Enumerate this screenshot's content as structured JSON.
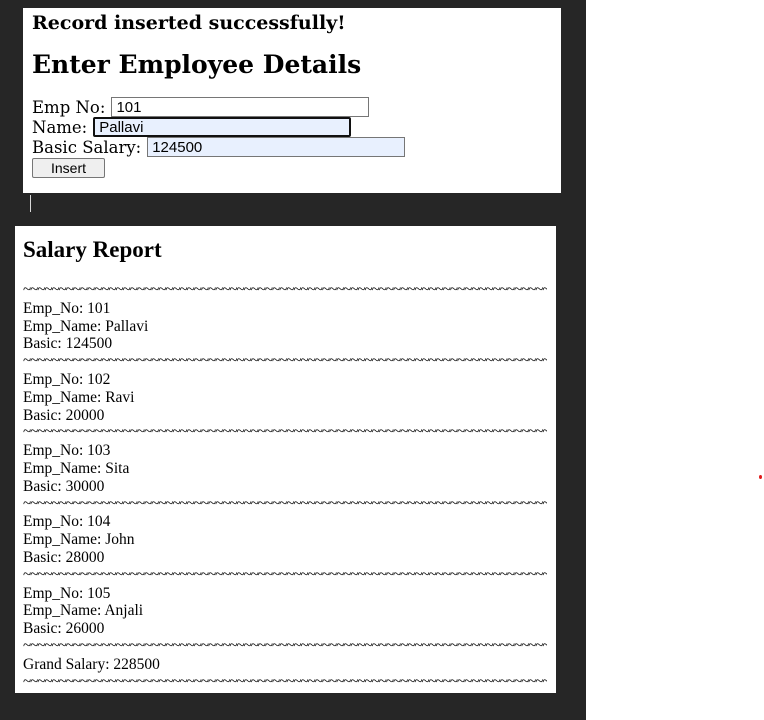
{
  "form": {
    "success_message": "Record inserted successfully!",
    "title": "Enter Employee Details",
    "emp_no_label": "Emp No:",
    "emp_no_value": "101",
    "name_label": "Name:",
    "name_value": "Pallavi",
    "basic_salary_label": "Basic Salary:",
    "basic_salary_value": "124500",
    "insert_button_label": "Insert"
  },
  "report": {
    "title": "Salary Report",
    "separator": "~~~~~~~~~~~~~~~~~~~~~~~~~~~~~~~~~~~~~~~~~~~~~~~~~~~~~~~~~~~~~~~~~~~~~~~~~~~~~~~~~~~~~~~~~~~~",
    "records": [
      {
        "emp_no": "Emp_No: 101",
        "emp_name": "Emp_Name: Pallavi",
        "basic": "Basic: 124500"
      },
      {
        "emp_no": "Emp_No: 102",
        "emp_name": "Emp_Name: Ravi",
        "basic": "Basic: 20000"
      },
      {
        "emp_no": "Emp_No: 103",
        "emp_name": "Emp_Name: Sita",
        "basic": "Basic: 30000"
      },
      {
        "emp_no": "Emp_No: 104",
        "emp_name": "Emp_Name: John",
        "basic": "Basic: 28000"
      },
      {
        "emp_no": "Emp_No: 105",
        "emp_name": "Emp_Name: Anjali",
        "basic": "Basic: 26000"
      }
    ],
    "grand_salary": "Grand Salary: 228500"
  },
  "colors": {
    "background_dark": "#262626",
    "panel": "#ffffff",
    "autofill": "#e8f0fe",
    "marker": "#e01818"
  }
}
